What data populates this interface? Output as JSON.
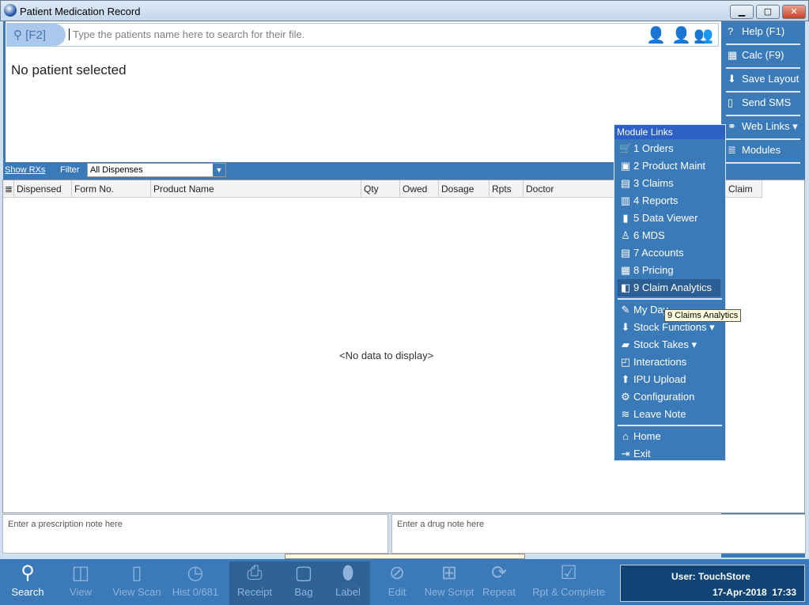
{
  "window": {
    "title": "Patient Medication Record",
    "minimize": "▁",
    "maximize": "▢",
    "close": "✕"
  },
  "search": {
    "hotkey": "[F2]",
    "placeholder": "Type the patients name here to search for their file."
  },
  "patient": {
    "status": "No patient selected"
  },
  "right_panel": [
    {
      "label": "Help (F1)",
      "icon": "help-icon",
      "g": "?"
    },
    {
      "label": "Calc (F9)",
      "icon": "calculator-icon",
      "g": "▦"
    },
    {
      "label": "Save Layout",
      "icon": "save-layout-icon",
      "g": "⬇"
    },
    {
      "label": "Send SMS",
      "icon": "sms-icon",
      "g": "▯"
    },
    {
      "label": "Web Links ▾",
      "icon": "link-icon",
      "g": "⚭"
    },
    {
      "label": "Modules",
      "icon": "modules-icon",
      "g": "≣"
    }
  ],
  "filterbar": {
    "show_rxs": "Show RXs",
    "filter": "Filter",
    "filter_value": "All Dispenses"
  },
  "grid": {
    "columns": [
      "Dispensed",
      "Form No.",
      "Product Name",
      "Qty",
      "Owed",
      "Dosage",
      "Rpts",
      "Doctor",
      "Claim"
    ],
    "empty": "<No data to display>"
  },
  "notes": {
    "prescription_placeholder": "Enter a prescription note here",
    "drug_placeholder": "Enter a drug note here"
  },
  "menu": {
    "header": "Module Links",
    "items": [
      {
        "label": "1 Orders",
        "g": "🛒"
      },
      {
        "label": "2 Product Maint",
        "g": "▣"
      },
      {
        "label": "3 Claims",
        "g": "▤"
      },
      {
        "label": "4 Reports",
        "g": "▥"
      },
      {
        "label": "5 Data Viewer",
        "g": "▮"
      },
      {
        "label": "6 MDS",
        "g": "♙"
      },
      {
        "label": "7 Accounts",
        "g": "▤"
      },
      {
        "label": "8 Pricing",
        "g": "▦"
      },
      {
        "label": "9 Claim Analytics",
        "g": "◧"
      }
    ],
    "items2": [
      {
        "label": "My Day",
        "g": "✎"
      },
      {
        "label": "Stock Functions ▾",
        "g": "⬇"
      },
      {
        "label": "Stock Takes ▾",
        "g": "▰"
      },
      {
        "label": "Interactions",
        "g": "◰"
      },
      {
        "label": "IPU Upload",
        "g": "⬆"
      },
      {
        "label": "Configuration",
        "g": "⚙"
      },
      {
        "label": "Leave Note",
        "g": "≋"
      }
    ],
    "items3": [
      {
        "label": "Home",
        "g": "⌂"
      },
      {
        "label": "Exit",
        "g": "⇥"
      }
    ]
  },
  "tooltip": "9 Claims Analytics",
  "toolbar": [
    {
      "label": "Search",
      "g": "⚲"
    },
    {
      "label": "View",
      "g": "◫"
    },
    {
      "label": "View Scan",
      "g": "▯"
    },
    {
      "label": "Hist 0/681",
      "g": "◷"
    },
    {
      "label": "Receipt",
      "g": "⎙"
    },
    {
      "label": "Bag",
      "g": "▢"
    },
    {
      "label": "Label",
      "g": "⬮"
    },
    {
      "label": "Edit",
      "g": "⊘"
    },
    {
      "label": "New Script",
      "g": "⊞"
    },
    {
      "label": "Repeat",
      "g": "⟳"
    },
    {
      "label": "Rpt & Complete",
      "g": "☑"
    }
  ],
  "status": {
    "user": "User: TouchStore",
    "datetime": "17-Apr-2018  17:33"
  }
}
